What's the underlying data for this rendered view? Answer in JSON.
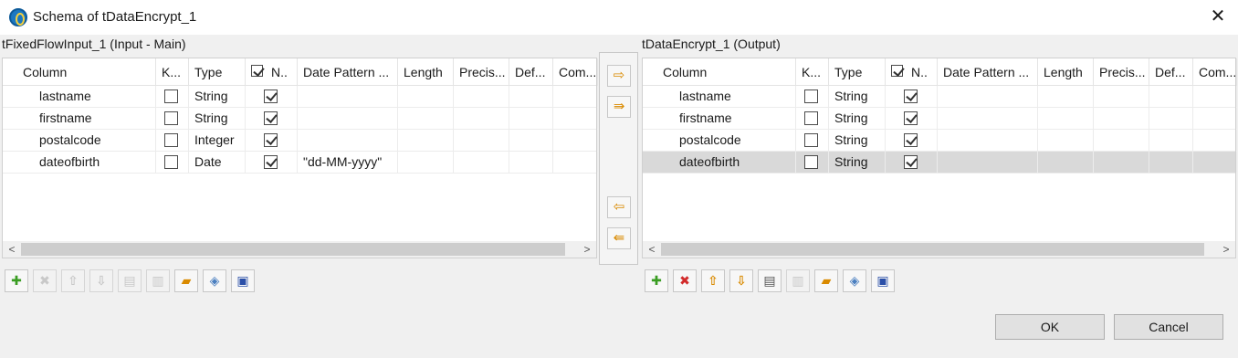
{
  "window": {
    "title": "Schema of tDataEncrypt_1"
  },
  "input_panel": {
    "label": "tFixedFlowInput_1 (Input - Main)",
    "columns": [
      "Column",
      "K...",
      "Type",
      "N..",
      "Date Pattern ...",
      "Length",
      "Precis...",
      "Def...",
      "Com..."
    ],
    "rows": [
      {
        "column": "lastname",
        "key": false,
        "type": "String",
        "nullable": true,
        "pattern": ""
      },
      {
        "column": "firstname",
        "key": false,
        "type": "String",
        "nullable": true,
        "pattern": ""
      },
      {
        "column": "postalcode",
        "key": false,
        "type": "Integer",
        "nullable": true,
        "pattern": ""
      },
      {
        "column": "dateofbirth",
        "key": false,
        "type": "Date",
        "nullable": true,
        "pattern": "\"dd-MM-yyyy\""
      }
    ]
  },
  "output_panel": {
    "label": "tDataEncrypt_1 (Output)",
    "columns": [
      "Column",
      "K...",
      "Type",
      "N..",
      "Date Pattern ...",
      "Length",
      "Precis...",
      "Def...",
      "Com..."
    ],
    "rows": [
      {
        "column": "lastname",
        "key": false,
        "type": "String",
        "nullable": true,
        "pattern": ""
      },
      {
        "column": "firstname",
        "key": false,
        "type": "String",
        "nullable": true,
        "pattern": ""
      },
      {
        "column": "postalcode",
        "key": false,
        "type": "String",
        "nullable": true,
        "pattern": ""
      },
      {
        "column": "dateofbirth",
        "key": false,
        "type": "String",
        "nullable": true,
        "pattern": "",
        "selected": true
      }
    ]
  },
  "transfer_buttons": [
    "copy-selected-right-icon",
    "copy-all-right-icon",
    "copy-selected-left-icon",
    "copy-all-left-icon"
  ],
  "toolbar_icons": [
    "add-icon",
    "remove-icon",
    "move-up-icon",
    "move-down-icon",
    "copy-icon",
    "paste-icon",
    "import-icon",
    "export-icon",
    "save-icon"
  ],
  "buttons": {
    "ok": "OK",
    "cancel": "Cancel"
  },
  "colors": {
    "accent": "#e59400",
    "add": "#3a9d23",
    "remove": "#d22b2b",
    "save": "#2a4fa8",
    "selected_row": "#d9d9d9"
  }
}
